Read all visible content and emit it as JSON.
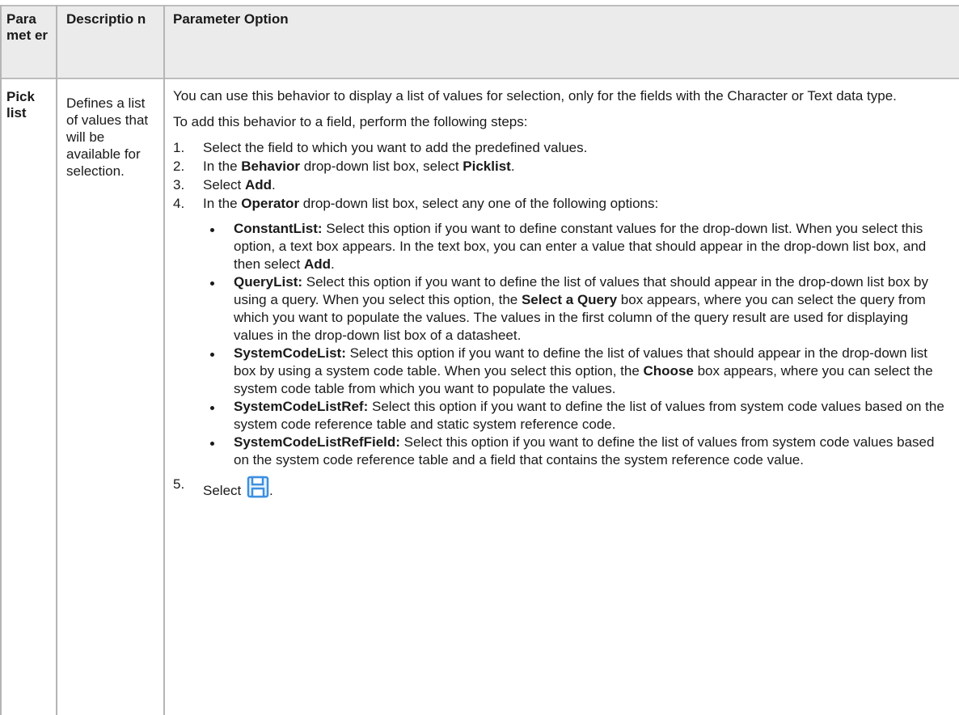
{
  "header": {
    "col1": "Para met er",
    "col2": "Descriptio n",
    "col3": "Parameter Option"
  },
  "row": {
    "parameter": "Pick list",
    "description": "Defines a list of values that will be available for selection.",
    "intro1": "You can use this behavior to display a list of values for selection, only for the fields with the Character or Text data type.",
    "intro2": "To add this behavior to a field, perform the following steps:",
    "steps": {
      "s1_num": "1.",
      "s1_text": "Select the field to which you want to add the predefined values.",
      "s2_num": "2.",
      "s2_a": "In the ",
      "s2_b1": "Behavior",
      "s2_c": " drop-down list box, select ",
      "s2_b2": "Picklist",
      "s2_d": ".",
      "s3_num": "3.",
      "s3_a": "Select ",
      "s3_b": "Add",
      "s3_c": ".",
      "s4_num": "4.",
      "s4_a": "In the ",
      "s4_b": "Operator",
      "s4_c": " drop-down list box, select any one of the following options:",
      "s5_num": "5.",
      "s5_a": "Select ",
      "s5_c": "."
    },
    "options": {
      "o1_name": "ConstantList:",
      "o1_text": " Select this option if you want to define constant values for the drop-down list. When you select this option, a text box appears. In the text box, you can enter a value that should appear in the drop-down list box, and then select ",
      "o1_b": "Add",
      "o1_end": ".",
      "o2_name": "QueryList:",
      "o2_text": " Select this option if you want to define the list of values that should appear in the drop-down list box by using a query. When you select this option, the ",
      "o2_b": "Select a Query",
      "o2_end": " box appears, where you can select the query from which you want to populate the values. The values in the first column of the query result are used for displaying values in the drop-down list box of a datasheet.",
      "o3_name": "SystemCodeList:",
      "o3_text": " Select this option if you want to define the list of values that should appear in the drop-down list box by using a system code table. When you select this option, the ",
      "o3_b": "Choose",
      "o3_end": " box appears, where you can select the system code table from which you want to populate the values.",
      "o4_name": "SystemCodeListRef:",
      "o4_text": " Select this option if you want to define the list of values from system code values based on the system code reference table and static system reference code.",
      "o5_name": "SystemCodeListRefField:",
      "o5_text": " Select this option if you want to define the list of values from system code values based on the system code reference table and a field that contains the system reference code value."
    }
  },
  "icons": {
    "save": "save-icon",
    "save_color": "#3d8fe0"
  }
}
